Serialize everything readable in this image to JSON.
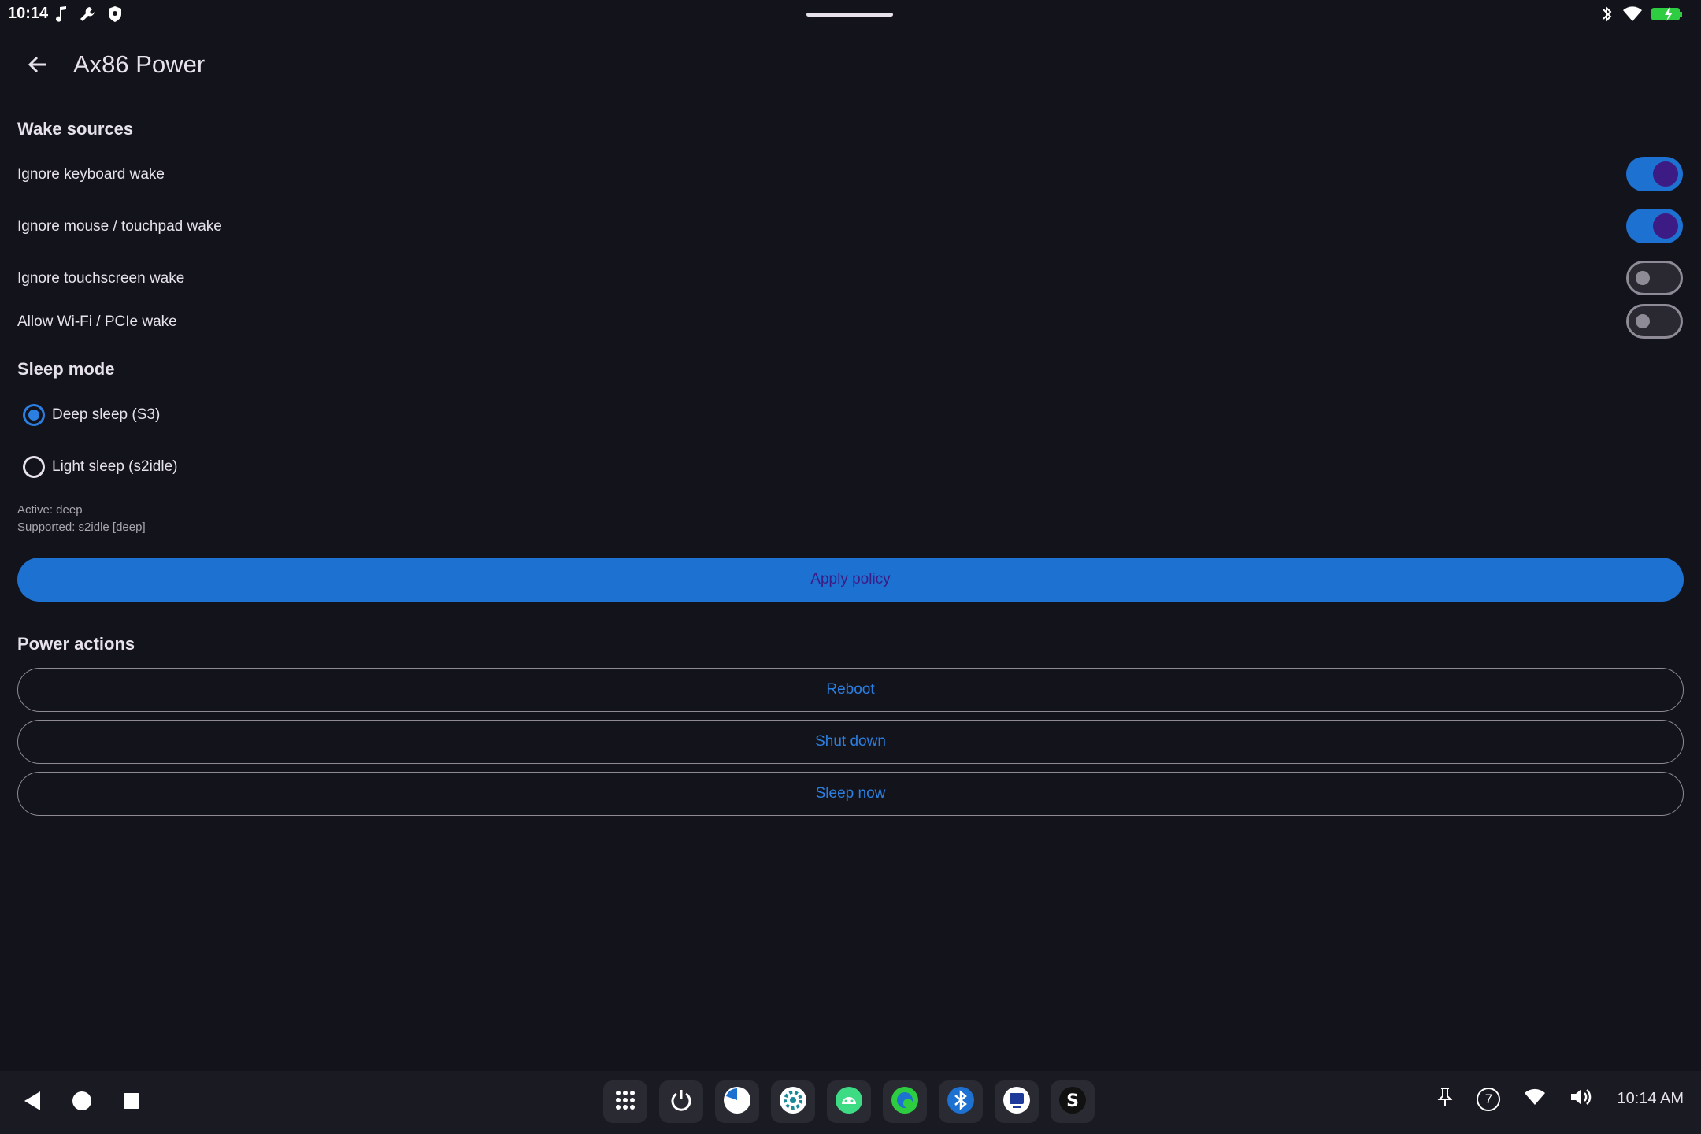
{
  "status": {
    "time": "10:14"
  },
  "appbar": {
    "title": "Ax86 Power"
  },
  "wake": {
    "title": "Wake sources",
    "items": [
      {
        "label": "Ignore keyboard wake",
        "on": true
      },
      {
        "label": "Ignore mouse / touchpad wake",
        "on": true
      },
      {
        "label": "Ignore touchscreen wake",
        "on": false
      },
      {
        "label": "Allow Wi-Fi / PCIe wake",
        "on": false
      }
    ]
  },
  "sleep": {
    "title": "Sleep mode",
    "options": [
      {
        "label": "Deep sleep (S3)",
        "selected": true
      },
      {
        "label": "Light sleep (s2idle)",
        "selected": false
      }
    ],
    "active": "Active: deep",
    "supported": "Supported: s2idle [deep]"
  },
  "apply_label": "Apply policy",
  "power": {
    "title": "Power actions",
    "reboot": "Reboot",
    "shutdown": "Shut down",
    "sleep_now": "Sleep now"
  },
  "taskbar": {
    "time": "10:14 AM",
    "notification_count": "7",
    "dock": [
      "apps-grid-icon",
      "power-icon",
      "pie-app-icon",
      "settings-gear-app-icon",
      "android-app-icon",
      "browser-app-icon",
      "bluetooth-app-icon",
      "display-app-icon",
      "s-app-icon"
    ]
  },
  "colors": {
    "accent": "#1d71d1",
    "background": "#13131b",
    "thumb": "#3d1b84"
  }
}
